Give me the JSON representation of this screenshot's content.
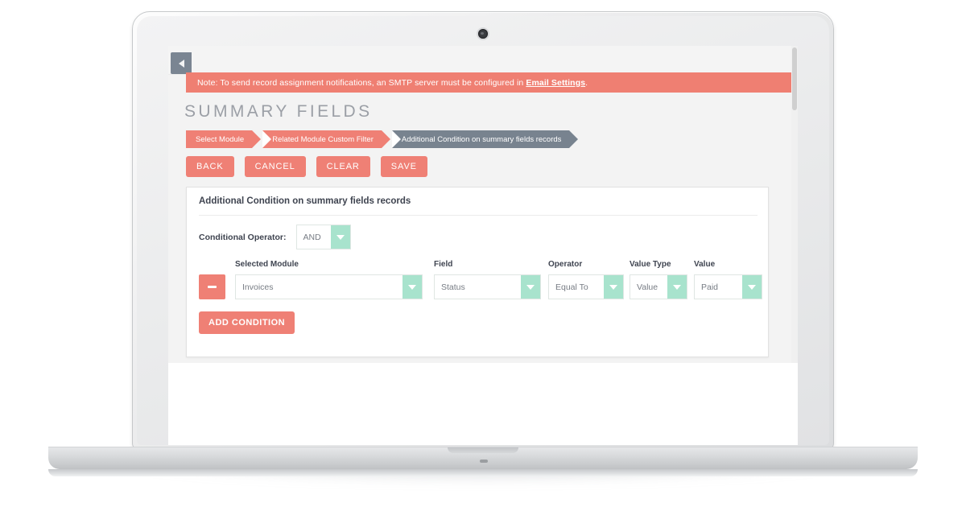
{
  "device": {
    "type": "laptop-mockup",
    "webcam": "webcam-dot"
  },
  "app": {
    "sidebar_toggle_icon": "chevron-left-icon",
    "notice": {
      "text_before": "Note: To send record assignment notifications, an SMTP server must be configured in ",
      "link_label": "Email Settings",
      "text_after": ".",
      "background_color": "#ef7f72"
    },
    "page_title": "SUMMARY FIELDS",
    "steps": [
      {
        "label": "Select Module",
        "state": "done",
        "color": "#ef8075"
      },
      {
        "label": "Related Module Custom Filter",
        "state": "done",
        "color": "#ef8075"
      },
      {
        "label": "Additional Condition on summary fields records",
        "state": "active",
        "color": "#78838f"
      }
    ],
    "actions": [
      {
        "label": "BACK",
        "name": "back-button"
      },
      {
        "label": "CANCEL",
        "name": "cancel-button"
      },
      {
        "label": "CLEAR",
        "name": "clear-button"
      },
      {
        "label": "SAVE",
        "name": "save-button"
      }
    ],
    "card": {
      "title": "Additional Condition on summary fields records",
      "conditional_operator": {
        "label": "Conditional Operator:",
        "value": "AND"
      },
      "columns": [
        {
          "label": "Selected Module"
        },
        {
          "label": "Field"
        },
        {
          "label": "Operator"
        },
        {
          "label": "Value Type"
        },
        {
          "label": "Value"
        }
      ],
      "condition_row": {
        "remove_icon": "minus-icon",
        "selected_module": "Invoices",
        "field": "Status",
        "operator": "Equal To",
        "value_type": "Value",
        "value": "Paid"
      },
      "add_condition_label": "ADD CONDITION"
    },
    "accent_colors": {
      "coral": "#ef8075",
      "mint": "#a8e3cd",
      "slate": "#78838f",
      "title_gray": "#9b9fa6"
    }
  }
}
